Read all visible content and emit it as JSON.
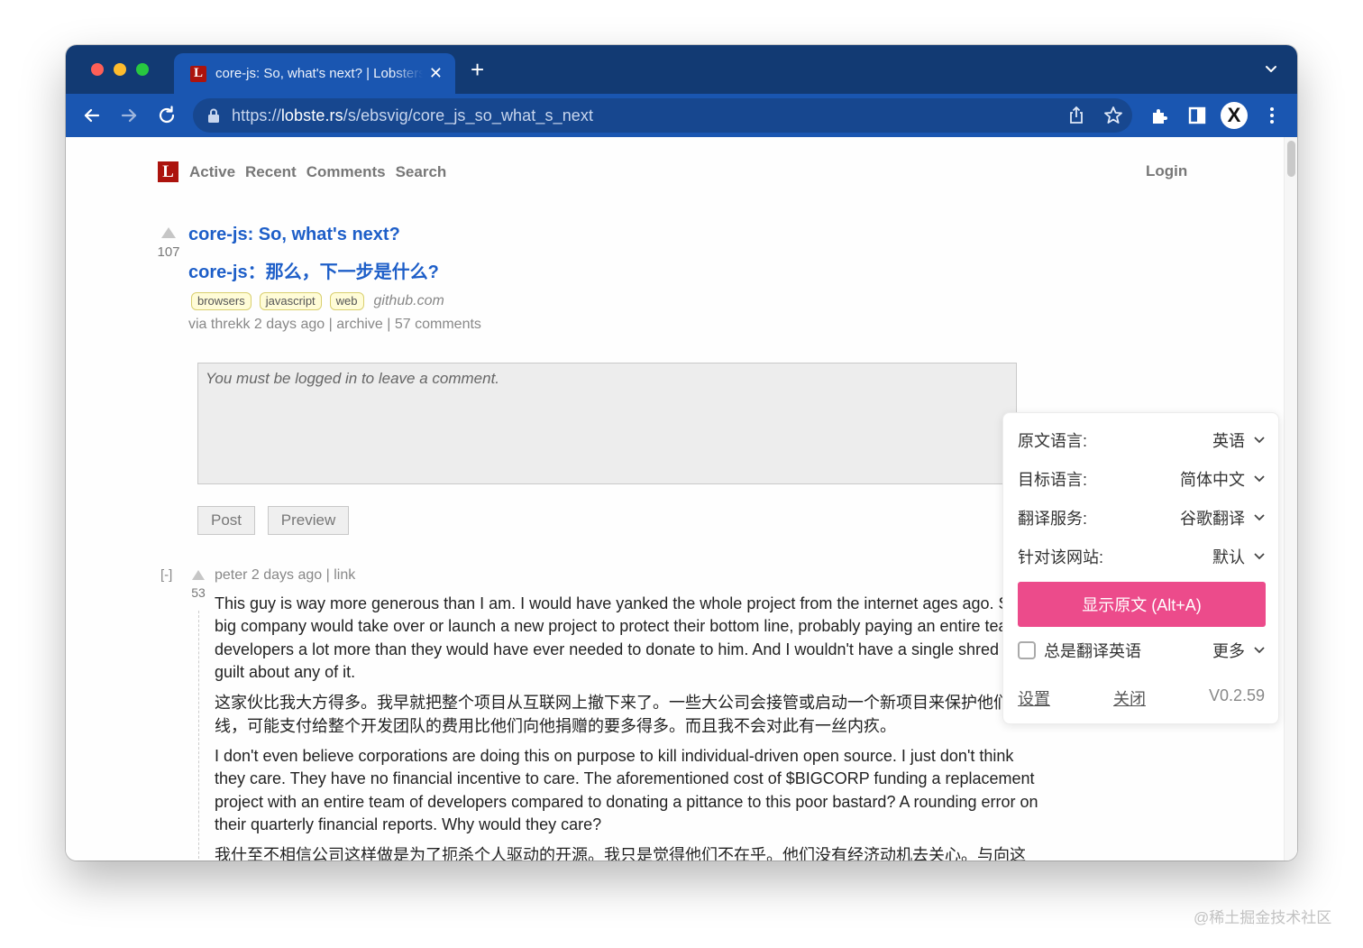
{
  "browser": {
    "tab_title": "core-js: So, what's next? | Lobsters",
    "tab_favicon_letter": "L",
    "url_prefix": "https://",
    "url_host": "lobste.rs",
    "url_path": "/s/ebsvig/core_js_so_what_s_next"
  },
  "site": {
    "logo_letter": "L",
    "nav": [
      "Active",
      "Recent",
      "Comments",
      "Search"
    ],
    "login": "Login"
  },
  "story": {
    "score": "107",
    "title": "core-js: So, what's next?",
    "title_translated": "core-js：那么，下一步是什么?",
    "tags": [
      "browsers",
      "javascript",
      "web"
    ],
    "domain": "github.com",
    "byline": "via threkk 2 days ago | archive | 57 comments"
  },
  "comment_form": {
    "placeholder": "You must be logged in to leave a comment.",
    "post_label": "Post",
    "preview_label": "Preview"
  },
  "comment": {
    "collapse": "[-]",
    "score": "53",
    "meta": "peter 2 days ago | link",
    "paragraphs": [
      "This guy is way more generous than I am. I would have yanked the whole project from the internet ages ago. Some big company would take over or launch a new project to protect their bottom line, probably paying an entire team of developers a lot more than they would have ever needed to donate to him. And I wouldn't have a single shred of guilt about any of it.",
      "这家伙比我大方得多。我早就把整个项目从互联网上撤下来了。一些大公司会接管或启动一个新项目来保护他们的底线，可能支付给整个开发团队的费用比他们向他捐赠的要多得多。而且我不会对此有一丝内疚。",
      "I don't even believe corporations are doing this on purpose to kill individual-driven open source. I just don't think they care. They have no financial incentive to care. The aforementioned cost of $BIGCORP funding a replacement project with an entire team of developers compared to donating a pittance to this poor bastard? A rounding error on their quarterly financial reports. Why would they care?",
      "我什至不相信公司这样做是为了扼杀个人驱动的开源。我只是觉得他们不在乎。他们没有经济动机去关心。与向这"
    ]
  },
  "translator": {
    "rows": [
      {
        "label": "原文语言:",
        "value": "英语"
      },
      {
        "label": "目标语言:",
        "value": "简体中文"
      },
      {
        "label": "翻译服务:",
        "value": "谷歌翻译"
      },
      {
        "label": "针对该网站:",
        "value": "默认"
      }
    ],
    "show_original": "显示原文 (Alt+A)",
    "always_translate": "总是翻译英语",
    "more": "更多",
    "settings": "设置",
    "close": "关闭",
    "version": "V0.2.59",
    "accent_color": "#ec4b8b"
  },
  "watermark": "@稀土掘金技术社区"
}
